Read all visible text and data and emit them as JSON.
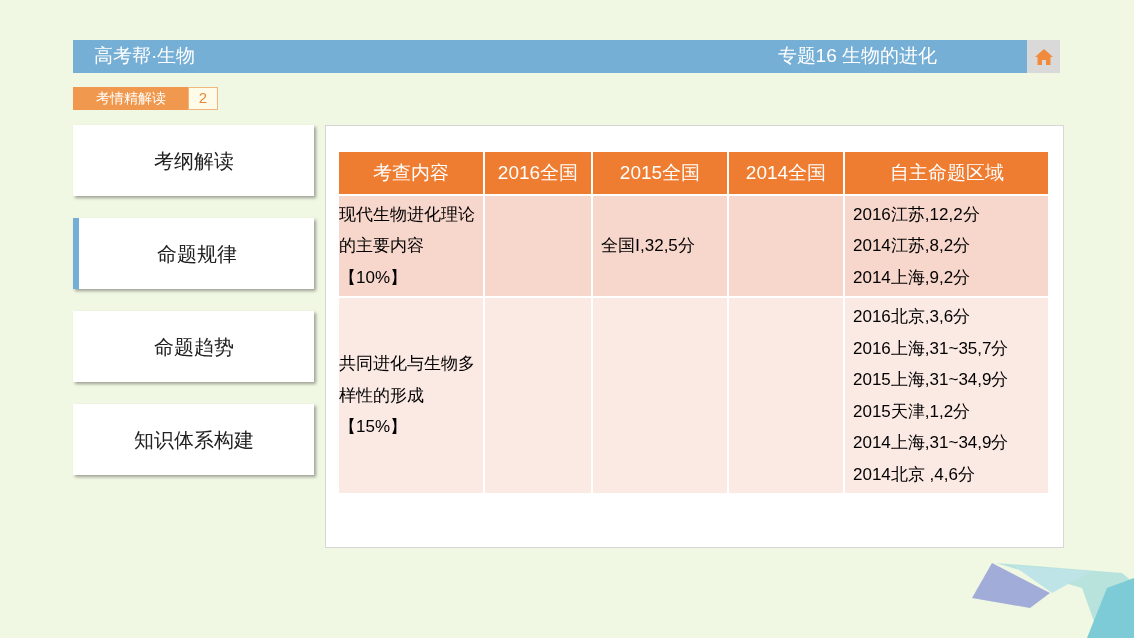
{
  "header": {
    "brand": "高考帮·生物",
    "topic": "专题16 生物的进化"
  },
  "section_tag": {
    "label": "考情精解读",
    "number": "2"
  },
  "sidebar": {
    "items": [
      {
        "label": "考纲解读",
        "selected": false
      },
      {
        "label": "命题规律",
        "selected": true
      },
      {
        "label": "命题趋势",
        "selected": false
      },
      {
        "label": "知识体系构建",
        "selected": false
      }
    ]
  },
  "table": {
    "columns": [
      "考查内容",
      "2016全国",
      "2015全国",
      "2014全国",
      "自主命题区域"
    ],
    "rows": [
      {
        "cells": [
          [
            "现代生物进化理论",
            "的主要内容",
            "【10%】"
          ],
          [],
          [
            "全国Ⅰ,32,5分"
          ],
          [],
          [
            "2016江苏,12,2分",
            "2014江苏,8,2分",
            "2014上海,9,2分"
          ]
        ]
      },
      {
        "cells": [
          [
            "共同进化与生物多",
            "样性的形成",
            "【15%】"
          ],
          [],
          [],
          [],
          [
            "2016北京,3,6分",
            "2016上海,31~35,7分",
            "2015上海,31~34,9分",
            "2015天津,1,2分",
            "2014上海,31~34,9分",
            "2014北京 ,4,6分"
          ]
        ]
      }
    ]
  }
}
